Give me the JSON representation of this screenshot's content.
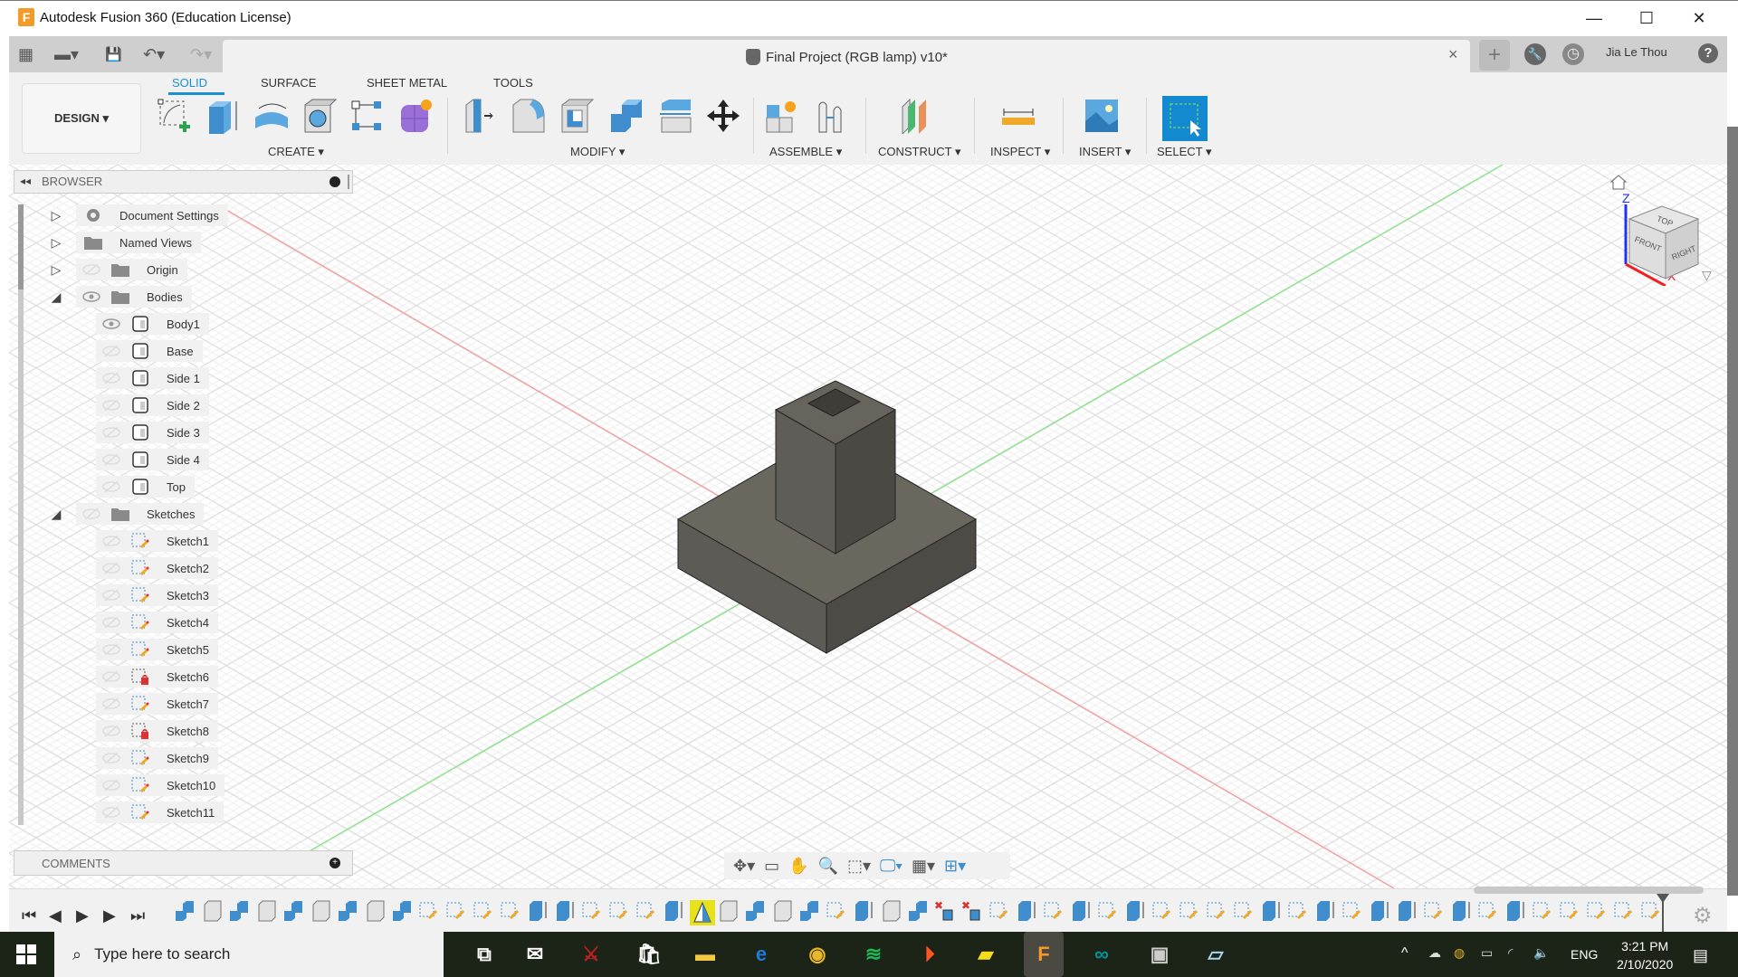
{
  "window": {
    "title": "Autodesk Fusion 360 (Education License)",
    "logo_letter": "F",
    "minimize": "—",
    "maximize": "☐",
    "close": "✕"
  },
  "document_tab": {
    "title": "Final Project (RGB lamp) v10*",
    "close": "×"
  },
  "quick_access": {
    "grid": "▦",
    "file": "▬▾",
    "save": "💾",
    "undo": "↶▾",
    "redo": "↷▾"
  },
  "right_header": {
    "new_tab": "+",
    "job_status": "🔧",
    "history": "◷",
    "user": "Jia Le Thou",
    "help": "?"
  },
  "ribbon": {
    "workspace": "DESIGN ▾",
    "tabs": [
      "SOLID",
      "SURFACE",
      "SHEET METAL",
      "TOOLS"
    ],
    "active_tab": "SOLID",
    "groups": [
      {
        "label": "CREATE ▾",
        "tools": [
          "create-sketch",
          "extrude",
          "revolve",
          "hole",
          "rectangular-pattern",
          "create-form"
        ]
      },
      {
        "label": "MODIFY ▾",
        "tools": [
          "press-pull",
          "fillet",
          "shell",
          "combine",
          "offset-face",
          "move-copy"
        ]
      },
      {
        "label": "ASSEMBLE ▾",
        "tools": [
          "new-component",
          "joint"
        ]
      },
      {
        "label": "CONSTRUCT ▾",
        "tools": [
          "offset-plane"
        ]
      },
      {
        "label": "INSPECT ▾",
        "tools": [
          "measure"
        ]
      },
      {
        "label": "INSERT ▾",
        "tools": [
          "insert-canvas"
        ]
      },
      {
        "label": "SELECT ▾",
        "tools": [
          "select"
        ]
      }
    ]
  },
  "browser": {
    "title": "BROWSER",
    "items": [
      {
        "label": "Document Settings",
        "level": 0,
        "expand": "▷",
        "icon": "gear",
        "visible": null
      },
      {
        "label": "Named Views",
        "level": 0,
        "expand": "▷",
        "icon": "folder",
        "visible": null
      },
      {
        "label": "Origin",
        "level": 0,
        "expand": "▷",
        "icon": "folder",
        "visible": false
      },
      {
        "label": "Bodies",
        "level": 0,
        "expand": "◢",
        "icon": "folder",
        "visible": true
      },
      {
        "label": "Body1",
        "level": 1,
        "icon": "body",
        "visible": true
      },
      {
        "label": "Base",
        "level": 1,
        "icon": "body",
        "visible": false
      },
      {
        "label": "Side 1",
        "level": 1,
        "icon": "body",
        "visible": false
      },
      {
        "label": "Side 2",
        "level": 1,
        "icon": "body",
        "visible": false
      },
      {
        "label": "Side 3",
        "level": 1,
        "icon": "body",
        "visible": false
      },
      {
        "label": "Side 4",
        "level": 1,
        "icon": "body",
        "visible": false
      },
      {
        "label": "Top",
        "level": 1,
        "icon": "body",
        "visible": false
      },
      {
        "label": "Sketches",
        "level": 0,
        "expand": "◢",
        "icon": "folder",
        "visible": false
      },
      {
        "label": "Sketch1",
        "level": 1,
        "icon": "sketch",
        "visible": false
      },
      {
        "label": "Sketch2",
        "level": 1,
        "icon": "sketch",
        "visible": false
      },
      {
        "label": "Sketch3",
        "level": 1,
        "icon": "sketch",
        "visible": false
      },
      {
        "label": "Sketch4",
        "level": 1,
        "icon": "sketch",
        "visible": false
      },
      {
        "label": "Sketch5",
        "level": 1,
        "icon": "sketch",
        "visible": false
      },
      {
        "label": "Sketch6",
        "level": 1,
        "icon": "sketch-locked",
        "visible": false
      },
      {
        "label": "Sketch7",
        "level": 1,
        "icon": "sketch",
        "visible": false
      },
      {
        "label": "Sketch8",
        "level": 1,
        "icon": "sketch-locked",
        "visible": false
      },
      {
        "label": "Sketch9",
        "level": 1,
        "icon": "sketch",
        "visible": false
      },
      {
        "label": "Sketch10",
        "level": 1,
        "icon": "sketch",
        "visible": false
      },
      {
        "label": "Sketch11",
        "level": 1,
        "icon": "sketch",
        "visible": false
      }
    ]
  },
  "comments": {
    "title": "COMMENTS"
  },
  "viewcube": {
    "top": "TOP",
    "front": "FRONT",
    "right": "RIGHT",
    "axis_z": "Z",
    "axis_x": "X"
  },
  "nav_toolbar": [
    "orbit",
    "look-at",
    "pan",
    "zoom",
    "fit",
    "display-settings",
    "grid-settings",
    "viewports"
  ],
  "timeline": {
    "controls": [
      "⏮",
      "◀",
      "▶",
      "▶",
      "⏭"
    ],
    "features": [
      "body",
      "extrude",
      "body",
      "extrude",
      "body",
      "extrude",
      "body",
      "extrude",
      "body",
      "sketch",
      "sketch",
      "sketch",
      "sketch",
      "extrude-solid",
      "extrude-solid",
      "sketch",
      "sketch",
      "sketch",
      "extrude-solid",
      "warning",
      "extrude",
      "body",
      "extrude",
      "body",
      "sketch",
      "extrude-solid",
      "extrude",
      "body",
      "delete",
      "delete",
      "sketch",
      "extrude-solid",
      "sketch",
      "extrude-solid",
      "sketch",
      "extrude-solid",
      "sketch",
      "sketch",
      "sketch",
      "sketch",
      "extrude-solid",
      "sketch",
      "extrude-solid",
      "sketch",
      "extrude-solid",
      "extrude-solid",
      "sketch",
      "extrude-solid",
      "sketch",
      "extrude-solid",
      "sketch",
      "sketch",
      "sketch",
      "sketch",
      "sketch"
    ],
    "warning_color": "#e8e21c"
  },
  "taskbar": {
    "search_placeholder": "Type here to search",
    "apps": [
      "task-view",
      "mail",
      "predator",
      "store",
      "file-explorer",
      "edge",
      "chrome",
      "spotify",
      "podcast",
      "sticky-notes",
      "fusion360",
      "arduino",
      "printer-app",
      "notepad"
    ],
    "language": "ENG",
    "time": "3:21 PM",
    "date": "2/10/2020"
  },
  "colors": {
    "accent": "#1a8fd6",
    "body": "#5f5d55",
    "x_axis": "#e85050",
    "y_axis": "#4ddc4d"
  }
}
